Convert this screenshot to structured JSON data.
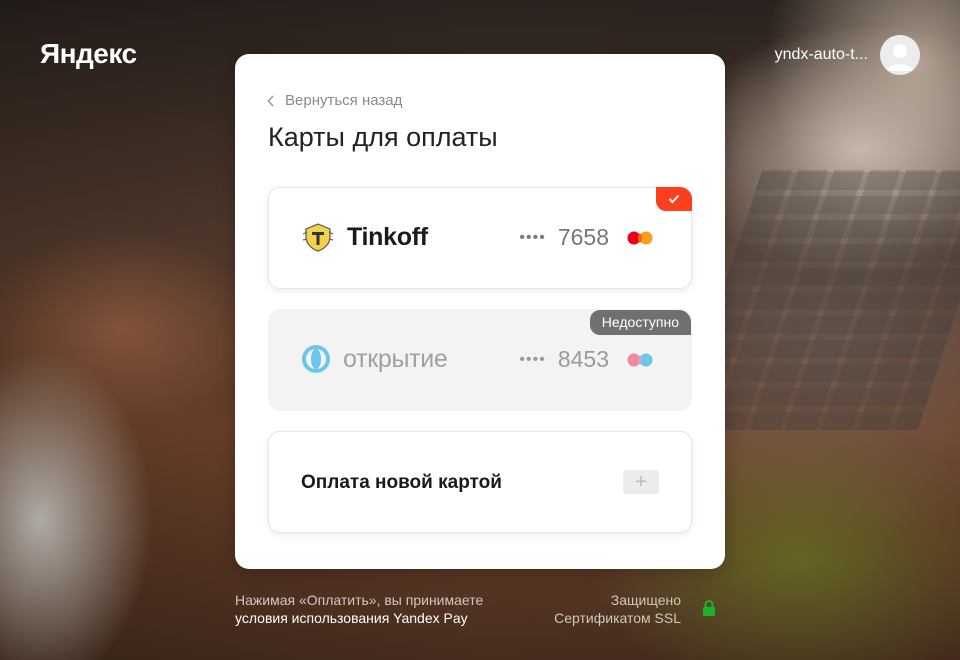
{
  "header": {
    "logo_text": "Яндекс",
    "user_name": "yndx-auto-t..."
  },
  "panel": {
    "back_label": "Вернуться назад",
    "title": "Карты для оплаты"
  },
  "cards": [
    {
      "bank": "Tinkoff",
      "masked": "••••",
      "last4": "7658",
      "selected": true,
      "available": true,
      "icon": "tinkoff-logo-icon",
      "payment_system": "mastercard-icon"
    },
    {
      "bank": "открытие",
      "masked": "••••",
      "last4": "8453",
      "selected": false,
      "available": false,
      "badge": "Недоступно",
      "icon": "otkritie-logo-icon",
      "payment_system": "mastercard-icon"
    }
  ],
  "new_card": {
    "label": "Оплата новой картой",
    "icon": "plus-icon"
  },
  "footer": {
    "terms_prefix": "Нажимая «Оплатить», вы принимаете",
    "terms_link": "условия использования Yandex Pay",
    "ssl_line1": "Защищено",
    "ssl_line2": "Сертификатом SSL",
    "lock_icon": "lock-icon"
  },
  "colors": {
    "accent": "#fc3f1d",
    "ssl_green": "#1db32b",
    "badge_gray": "#707070"
  }
}
